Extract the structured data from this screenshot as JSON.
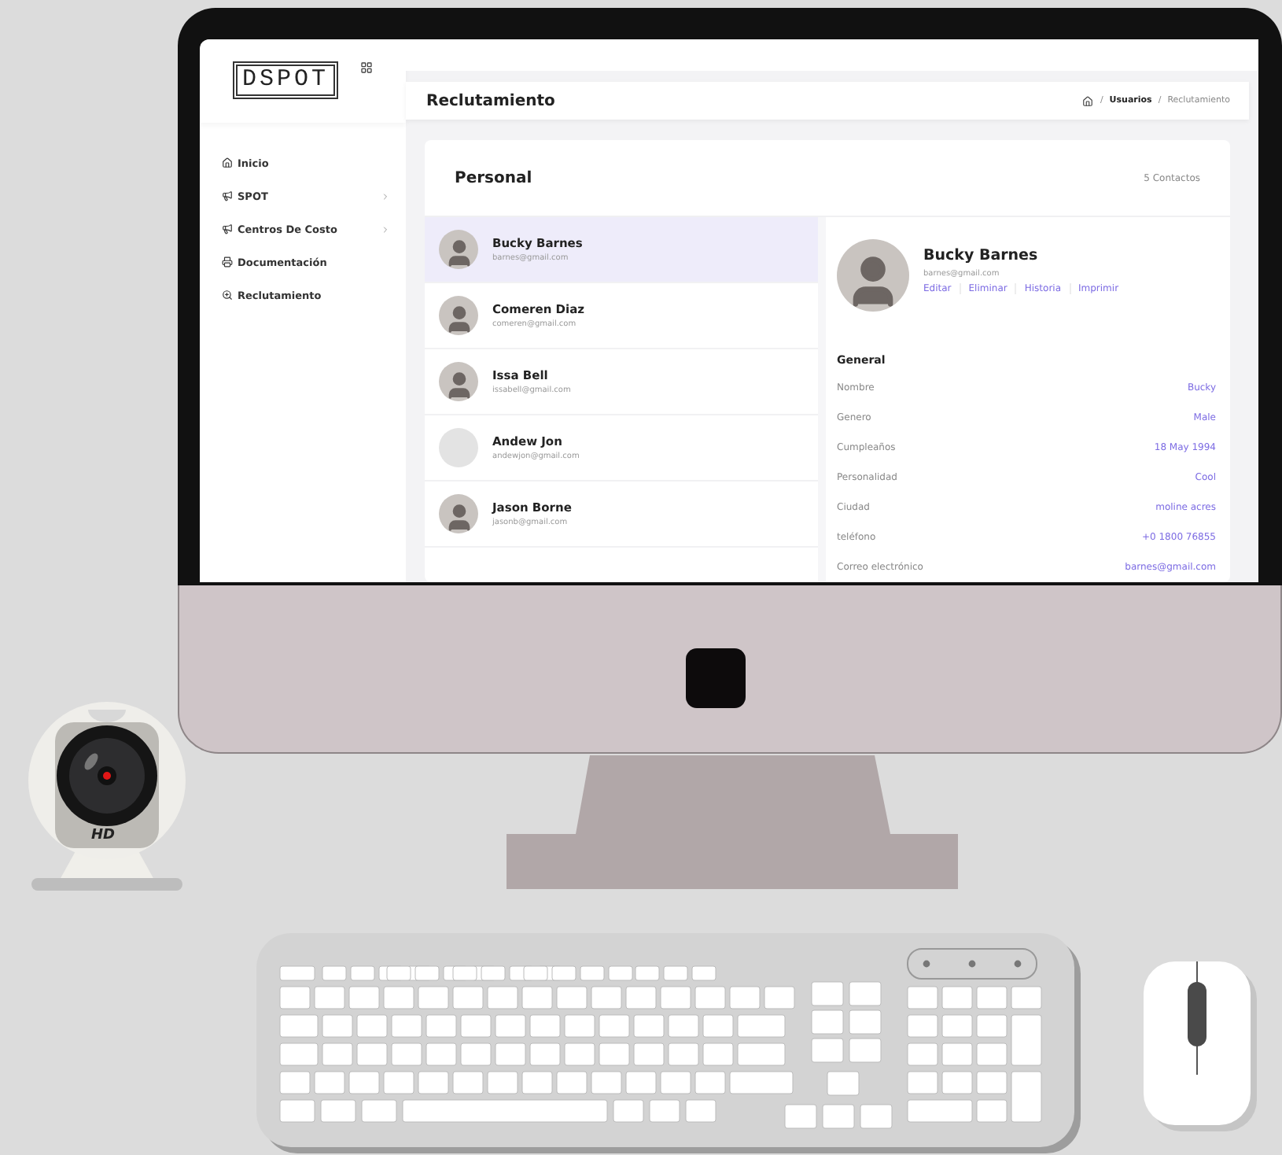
{
  "screen": {
    "sidebar": {
      "logo": "DSPOT",
      "items": [
        {
          "label": "Inicio",
          "has_submenu": false
        },
        {
          "label": "SPOT",
          "has_submenu": true
        },
        {
          "label": "Centros De Costo",
          "has_submenu": true
        },
        {
          "label": "Documentación",
          "has_submenu": false
        },
        {
          "label": "Reclutamiento",
          "has_submenu": false
        }
      ]
    },
    "page_title": "Reclutamiento",
    "breadcrumb": [
      {
        "separator": "/",
        "label": "Usuarios",
        "current": false
      },
      {
        "separator": "/",
        "label": "Reclutamiento",
        "current": true
      }
    ],
    "card": {
      "title": "Personal",
      "count": "5 Contactos",
      "contacts": [
        {
          "name": "Bucky Barnes",
          "email": "barnes@gmail.com",
          "selected": true,
          "photo": true
        },
        {
          "name": "Comeren Diaz",
          "email": "comeren@gmail.com",
          "selected": false,
          "photo": true
        },
        {
          "name": "Issa Bell",
          "email": "issabell@gmail.com",
          "selected": false,
          "photo": true
        },
        {
          "name": "Andew Jon",
          "email": "andewjon@gmail.com",
          "selected": false,
          "photo": false
        },
        {
          "name": "Jason Borne",
          "email": "jasonb@gmail.com",
          "selected": false,
          "photo": true
        }
      ],
      "detail": {
        "name": "Bucky Barnes",
        "email": "barnes@gmail.com",
        "actions": [
          "Editar",
          "Eliminar",
          "Historia",
          "Imprimir"
        ],
        "section": "General",
        "fields": [
          {
            "label": "Nombre",
            "value": "Bucky"
          },
          {
            "label": "Genero",
            "value": "Male"
          },
          {
            "label": "Cumpleaños",
            "value": "18 May 1994"
          },
          {
            "label": "Personalidad",
            "value": "Cool"
          },
          {
            "label": "Ciudad",
            "value": "moline acres"
          },
          {
            "label": "teléfono",
            "value": "+0 1800 76855"
          },
          {
            "label": "Correo electrónico",
            "value": "barnes@gmail.com"
          }
        ]
      }
    }
  },
  "webcam": {
    "label": "HD"
  }
}
